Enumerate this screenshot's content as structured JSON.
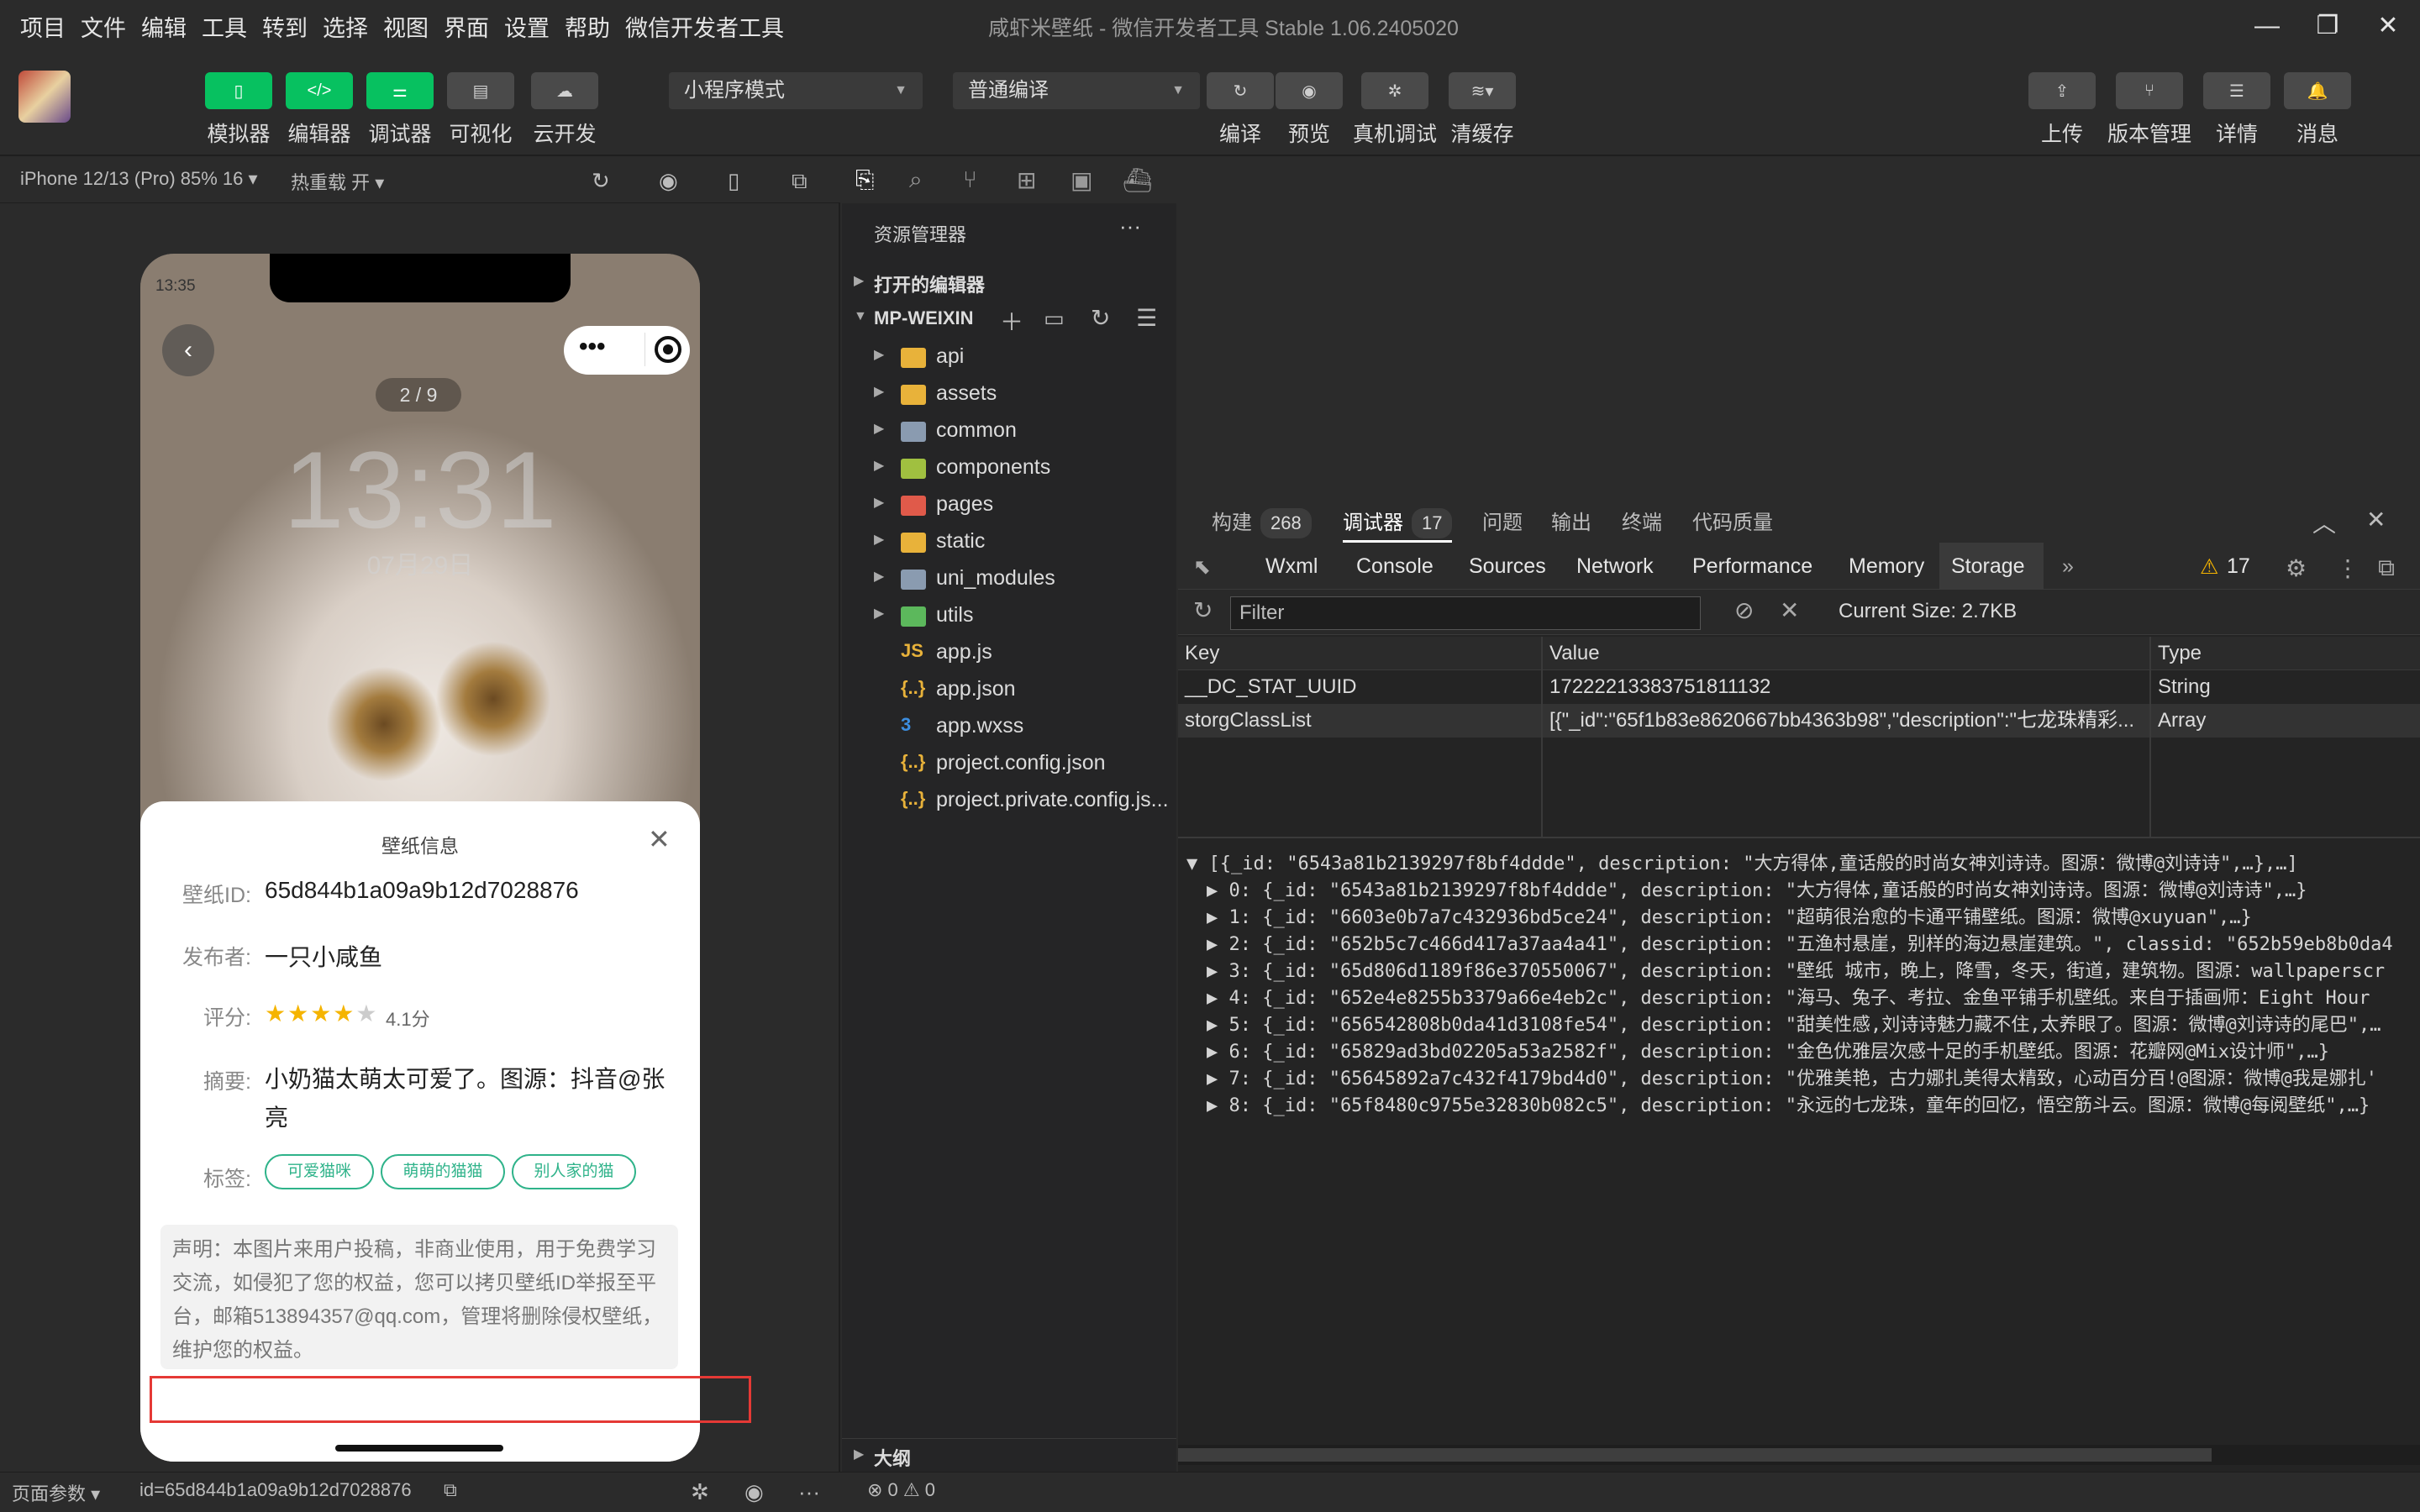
{
  "menu": [
    "项目",
    "文件",
    "编辑",
    "工具",
    "转到",
    "选择",
    "视图",
    "界面",
    "设置",
    "帮助",
    "微信开发者工具"
  ],
  "app_title": "咸虾米壁纸 - 微信开发者工具 Stable 1.06.2405020",
  "toolbar": {
    "left_labels": [
      "模拟器",
      "编辑器",
      "调试器",
      "可视化",
      "云开发"
    ],
    "mode_select": "小程序模式",
    "compile_select": "普通编译",
    "mid_labels": [
      "编译",
      "预览",
      "真机调试",
      "清缓存"
    ],
    "right_labels": [
      "上传",
      "版本管理",
      "详情",
      "消息"
    ]
  },
  "sim_header": {
    "device": "iPhone 12/13 (Pro) 85% 16 ▾",
    "hot_reload": "热重载 开 ▾"
  },
  "phone": {
    "status_time": "13:35",
    "page_indicator": "2 / 9",
    "big_time": "13:31",
    "big_date": "07月29日",
    "sheet_title": "壁纸信息",
    "fields": {
      "id_label": "壁纸ID:",
      "id_value": "65d844b1a09a9b12d7028876",
      "publisher_label": "发布者:",
      "publisher_value": "一只小咸鱼",
      "rating_label": "评分:",
      "rating_value": "4.1分",
      "rating_stars": 4,
      "summary_label": "摘要:",
      "summary_value": "小奶猫太萌太可爱了。图源：抖音@张亮",
      "tags_label": "标签:"
    },
    "tags": [
      "可爱猫咪",
      "萌萌的猫猫",
      "别人家的猫"
    ],
    "disclaimer": "声明：本图片来用户投稿，非商业使用，用于免费学习交流，如侵犯了您的权益，您可以拷贝壁纸ID举报至平台，邮箱513894357@qq.com，管理将删除侵权壁纸，维护您的权益。"
  },
  "footer": {
    "page_params": "页面参数 ▾",
    "page_id": "id=65d844b1a09a9b12d7028876",
    "errors": "⊗ 0 ⚠ 0"
  },
  "explorer": {
    "title": "资源管理器",
    "open_editors": "打开的编辑器",
    "project": "MP-WEIXIN",
    "outline": "大纲",
    "items": [
      {
        "name": "api",
        "type": "folder",
        "color": "#e8b23a"
      },
      {
        "name": "assets",
        "type": "folder",
        "color": "#e8b23a"
      },
      {
        "name": "common",
        "type": "folder",
        "color": "#8a9bb0"
      },
      {
        "name": "components",
        "type": "folder",
        "color": "#a0c040"
      },
      {
        "name": "pages",
        "type": "folder",
        "color": "#e05a4a"
      },
      {
        "name": "static",
        "type": "folder",
        "color": "#e8b23a"
      },
      {
        "name": "uni_modules",
        "type": "folder",
        "color": "#8a9bb0"
      },
      {
        "name": "utils",
        "type": "folder",
        "color": "#5cb85c"
      },
      {
        "name": "app.js",
        "type": "js",
        "color": "#e8b23a"
      },
      {
        "name": "app.json",
        "type": "json",
        "color": "#e8b23a"
      },
      {
        "name": "app.wxss",
        "type": "wxss",
        "color": "#3c8ee0"
      },
      {
        "name": "project.config.json",
        "type": "json",
        "color": "#e8b23a"
      },
      {
        "name": "project.private.config.js...",
        "type": "json",
        "color": "#e8b23a"
      }
    ]
  },
  "devtools": {
    "top_tabs": [
      {
        "label": "构建",
        "badge": "268"
      },
      {
        "label": "调试器",
        "badge": "17"
      },
      {
        "label": "问题",
        "badge": ""
      },
      {
        "label": "输出",
        "badge": ""
      },
      {
        "label": "终端",
        "badge": ""
      },
      {
        "label": "代码质量",
        "badge": ""
      }
    ],
    "panel_tabs": [
      "Wxml",
      "Console",
      "Sources",
      "Network",
      "Performance",
      "Memory",
      "Storage"
    ],
    "warn_count": "17",
    "filter_placeholder": "Filter",
    "current_size": "Current Size: 2.7KB",
    "columns": [
      "Key",
      "Value",
      "Type"
    ],
    "rows": [
      {
        "key": "__DC_STAT_UUID",
        "value": "17222213383751811132",
        "type": "String"
      },
      {
        "key": "storgClassList",
        "value": "[{\"_id\":\"65f1b83e8620667bb4363b98\",\"description\":\"七龙珠精彩...",
        "type": "Array"
      }
    ],
    "json_root": "▼ [{_id: \"6543a81b2139297f8bf4ddde\", description: \"大方得体,童话般的时尚女神刘诗诗。图源：微博@刘诗诗\",…},…]",
    "json_items": [
      "▶ 0: {_id: \"6543a81b2139297f8bf4ddde\", description: \"大方得体,童话般的时尚女神刘诗诗。图源：微博@刘诗诗\",…}",
      "▶ 1: {_id: \"6603e0b7a7c432936bd5ce24\", description: \"超萌很治愈的卡通平铺壁纸。图源：微博@xuyuan\",…}",
      "▶ 2: {_id: \"652b5c7c466d417a37aa4a41\", description: \"五渔村悬崖，别样的海边悬崖建筑。\", classid: \"652b59eb8b0da4",
      "▶ 3: {_id: \"65d806d1189f86e370550067\", description: \"壁纸 城市，晚上，降雪，冬天，街道，建筑物。图源：wallpaperscr",
      "▶ 4: {_id: \"652e4e8255b3379a66e4eb2c\", description: \"海马、兔子、考拉、金鱼平铺手机壁纸。来自于插画师：Eight Hour",
      "▶ 5: {_id: \"656542808b0da41d3108fe54\", description: \"甜美性感,刘诗诗魅力藏不住,太养眼了。图源：微博@刘诗诗的尾巴\",…",
      "▶ 6: {_id: \"65829ad3bd02205a53a2582f\", description: \"金色优雅层次感十足的手机壁纸。图源：花瓣网@Mix设计师\",…}",
      "▶ 7: {_id: \"65645892a7c432f4179bd4d0\", description: \"优雅美艳，古力娜扎美得太精致，心动百分百!@图源：微博@我是娜扎'",
      "▶ 8: {_id: \"65f8480c9755e32830b082c5\", description: \"永远的七龙珠，童年的回忆，悟空筋斗云。图源：微博@每阅壁纸\",…}"
    ]
  }
}
